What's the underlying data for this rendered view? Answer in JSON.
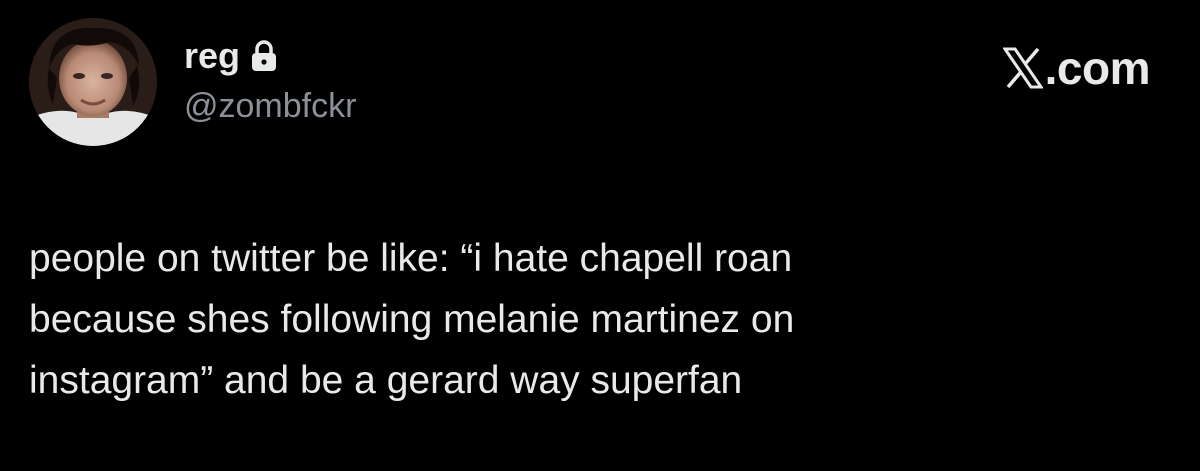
{
  "author": {
    "display_name": "reg",
    "handle": "@zombfckr",
    "protected_icon": "lock-icon",
    "avatar": "profile-photo"
  },
  "brand": {
    "logo_icon": "x-logo-icon",
    "label": ".com"
  },
  "tweet": {
    "lines": [
      "people on twitter be like: “i hate chapell roan",
      "because shes following melanie martinez on",
      "instagram” and be a gerard way superfan"
    ]
  },
  "colors": {
    "background": "#000000",
    "primary_text": "#e7e9ea",
    "secondary_text": "#8b9197"
  }
}
